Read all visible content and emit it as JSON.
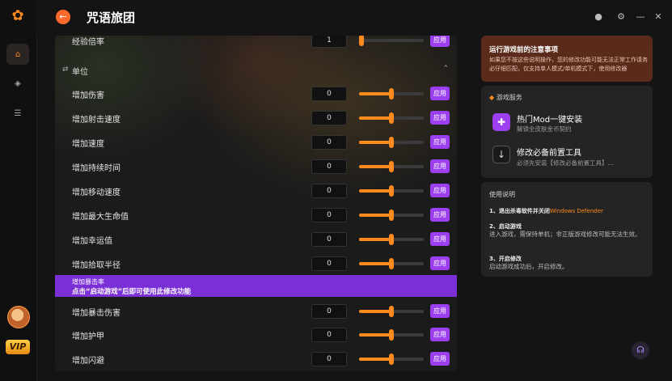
{
  "app": {
    "title": "咒语旅团"
  },
  "top_partial": {
    "label": "经验倍率",
    "value": "1",
    "apply": "应用",
    "progress": 0.0
  },
  "section": {
    "label": "单位"
  },
  "rows": [
    {
      "label": "增加伤害",
      "value": "0",
      "apply": "应用",
      "progress": 0.5
    },
    {
      "label": "增加射击速度",
      "value": "0",
      "apply": "应用",
      "progress": 0.5
    },
    {
      "label": "增加速度",
      "value": "0",
      "apply": "应用",
      "progress": 0.5
    },
    {
      "label": "增加持续时间",
      "value": "0",
      "apply": "应用",
      "progress": 0.5
    },
    {
      "label": "增加移动速度",
      "value": "0",
      "apply": "应用",
      "progress": 0.5
    },
    {
      "label": "增加最大生命值",
      "value": "0",
      "apply": "应用",
      "progress": 0.5
    },
    {
      "label": "增加幸运值",
      "value": "0",
      "apply": "应用",
      "progress": 0.5
    },
    {
      "label": "增加拾取半径",
      "value": "0",
      "apply": "应用",
      "progress": 0.5
    }
  ],
  "tooltip": {
    "row_label": "增加暴击率",
    "message": "点击“启动游戏”后即可使用此修改功能"
  },
  "rows_after": [
    {
      "label": "增加暴击伤害",
      "value": "0",
      "apply": "应用",
      "progress": 0.5
    },
    {
      "label": "增加护甲",
      "value": "0",
      "apply": "应用",
      "progress": 0.5
    },
    {
      "label": "增加闪避",
      "value": "0",
      "apply": "应用",
      "progress": 0.5
    }
  ],
  "notice": {
    "title": "运行游戏前的注意事项",
    "body": "如果您不按这些说明操作，您的修改功能可能无法正常工作请务必仔细匹配，仅支持单人模式/单机模式下，使用修改器"
  },
  "services": {
    "header": "游戏服务",
    "items": [
      {
        "title": "热门Mod一键安装",
        "subtitle": "解锁全皮肤金币契约"
      },
      {
        "title": "修改必备前置工具",
        "subtitle": "必须先安装【修改必备前置工具】..."
      }
    ]
  },
  "help": {
    "title": "使用说明",
    "step1": "1、退出杀毒软件并关闭",
    "step1_highlight": "Windows Defender",
    "step2": "2、启动游戏",
    "step2_body": "进入游戏，需保持单机；非正版游戏修改可能无法生效。",
    "step3": "3、开启修改",
    "step3_body": "启动游戏成功后，开启修改。"
  },
  "vip": {
    "label": "VIP"
  },
  "colors": {
    "accent": "#ff8a1d",
    "apply": "#9c3ff0",
    "tooltip": "#7b2fd6",
    "notice_bg": "#5a2a1a"
  }
}
